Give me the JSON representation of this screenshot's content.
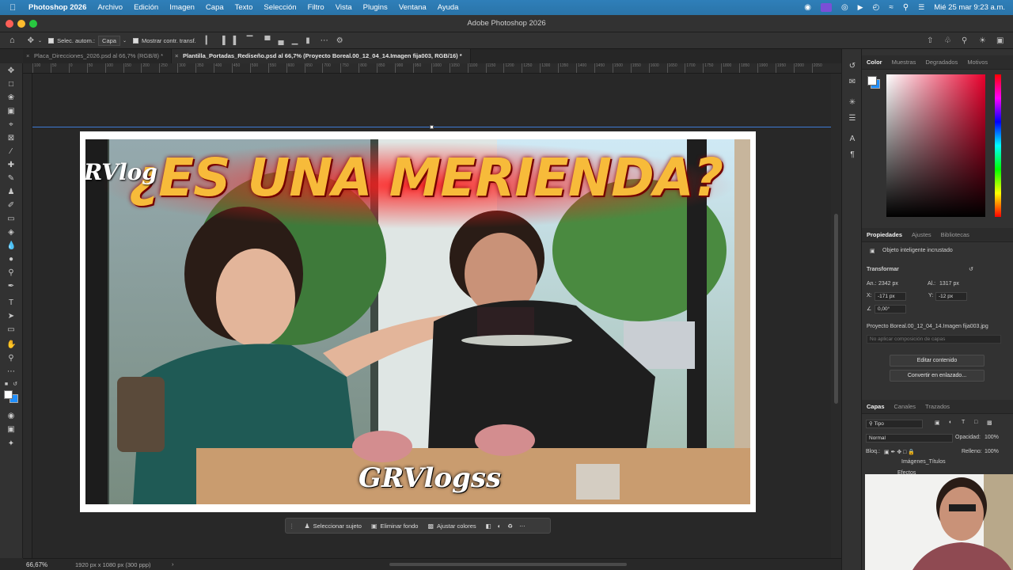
{
  "menubar": {
    "app_name": "Photoshop 2026",
    "items": [
      "Archivo",
      "Edición",
      "Imagen",
      "Capa",
      "Texto",
      "Selección",
      "Filtro",
      "Vista",
      "Plugins",
      "Ventana",
      "Ayuda"
    ],
    "datetime": "Mié 25 mar 9:23 a.m."
  },
  "window": {
    "title": "Adobe Photoshop 2026"
  },
  "options": {
    "auto_select_label": "Selec. autom.:",
    "auto_select_value": "Capa",
    "show_transform_label": "Mostrar contr. transf."
  },
  "tabs": [
    {
      "label": "Placa_Direcciones_2026.psd al 66,7% (RGB/8) *",
      "active": false
    },
    {
      "label": "Plantilla_Portadas_Rediseño.psd al 66,7% (Proyecto Boreal.00_12_04_14.Imagen fija003, RGB/16) *",
      "active": true
    }
  ],
  "ruler_ticks": [
    "100",
    "50",
    "0",
    "50",
    "100",
    "150",
    "200",
    "250",
    "300",
    "350",
    "400",
    "450",
    "500",
    "550",
    "600",
    "650",
    "700",
    "750",
    "800",
    "850",
    "900",
    "950",
    "1000",
    "1050",
    "1100",
    "1150",
    "1200",
    "1250",
    "1300",
    "1350",
    "1400",
    "1450",
    "1500",
    "1550",
    "1600",
    "1650",
    "1700",
    "1750",
    "1800",
    "1850",
    "1900",
    "1950",
    "2000",
    "2050"
  ],
  "canvas": {
    "headline": "¿ES UNA MERIENDA?",
    "corner_text": "RVlog",
    "watermark": "GRVlogss"
  },
  "context_bar": {
    "select_subject": "Seleccionar sujeto",
    "remove_background": "Eliminar fondo",
    "adjust_colors": "Ajustar colores"
  },
  "status": {
    "zoom": "66,67%",
    "doc_info": "1920 px x 1080 px (300 ppp)"
  },
  "color_panel": {
    "tabs": [
      "Color",
      "Muestras",
      "Degradados",
      "Motivos"
    ],
    "foreground": "#ffffff",
    "background": "#1f8fff"
  },
  "properties_panel": {
    "tabs": [
      "Propiedades",
      "Ajustes",
      "Bibliotecas"
    ],
    "object_type": "Objeto inteligente incrustado",
    "section": "Transformar",
    "an_label": "An.:",
    "an_value": "2342 px",
    "al_label": "Al.:",
    "al_value": "1317 px",
    "x_label": "X:",
    "x_value": "-171 px",
    "y_label": "Y:",
    "y_value": "-12 px",
    "angle_value": "0,00°",
    "source_name": "Proyecto Boreal.00_12_04_14.Imagen fija003.jpg",
    "comp_placeholder": "No aplicar composición de capas",
    "edit_button": "Editar contenido",
    "convert_button": "Convertir en enlazado..."
  },
  "layers_panel": {
    "tabs": [
      "Capas",
      "Canales",
      "Trazados"
    ],
    "filter_label": "Tipo",
    "blend_mode": "Normal",
    "opacity_label": "Opacidad:",
    "opacity_value": "100%",
    "lock_label": "Bloq.:",
    "fill_label": "Relleno:",
    "fill_value": "100%",
    "layer_name": "Imágenes_Títulos",
    "effects_label": "Efectos"
  }
}
